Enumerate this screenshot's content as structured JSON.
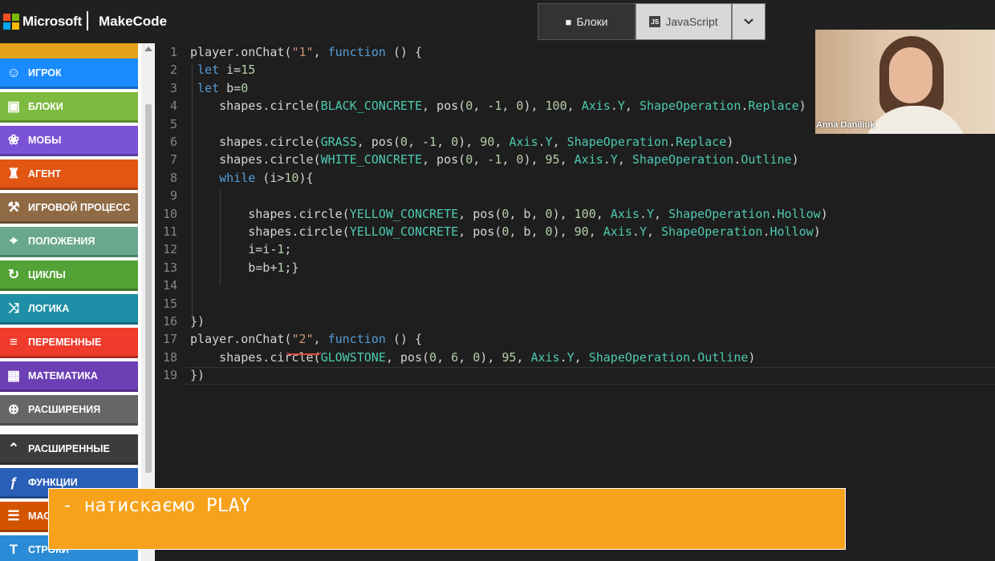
{
  "header": {
    "brand": "Microsoft",
    "product": "MakeCode",
    "mode_blocks": "Блоки",
    "mode_js": "JavaScript",
    "js_badge": "JS"
  },
  "sidebar": {
    "categories": [
      {
        "label": "",
        "icon": "truncated-icon",
        "color": "#e6a21a"
      },
      {
        "label": "ИГРОК",
        "icon": "person-icon",
        "color": "#1a8cff"
      },
      {
        "label": "БЛОКИ",
        "icon": "cube-icon",
        "color": "#7cbb3f"
      },
      {
        "label": "МОБЫ",
        "icon": "paw-icon",
        "color": "#7b53d6"
      },
      {
        "label": "АГЕНТ",
        "icon": "agent-icon",
        "color": "#e25513"
      },
      {
        "label": "ИГРОВОЙ ПРОЦЕСС",
        "icon": "wrench-icon",
        "color": "#8f6a44"
      },
      {
        "label": "ПОЛОЖЕНИЯ",
        "icon": "crosshair-icon",
        "color": "#6aa88e"
      },
      {
        "label": "ЦИКЛЫ",
        "icon": "loop-icon",
        "color": "#53a235"
      },
      {
        "label": "ЛОГИКА",
        "icon": "shuffle-icon",
        "color": "#1f8ea6"
      },
      {
        "label": "ПЕРЕМЕННЫЕ",
        "icon": "list-icon",
        "color": "#ee3b2b"
      },
      {
        "label": "МАТЕМАТИКА",
        "icon": "calculator-icon",
        "color": "#6c3fb4"
      },
      {
        "label": "РАСШИРЕНИЯ",
        "icon": "plus-circle-icon",
        "color": "#666666"
      },
      {
        "label": "РАСШИРЕННЫЕ",
        "icon": "chevron-up-icon",
        "color": "#3c3c3c"
      },
      {
        "label": "ФУНКЦИИ",
        "icon": "function-icon",
        "color": "#2a5fb8"
      },
      {
        "label": "МАС",
        "icon": "array-icon",
        "color": "#d35400"
      },
      {
        "label": "СТРОКИ",
        "icon": "text-icon",
        "color": "#2a8bd6"
      }
    ]
  },
  "editor": {
    "lines": [
      {
        "n": "1",
        "html": "player.onChat(<span class='str'>\"1\"</span>, <span class='kw'>function</span> () {"
      },
      {
        "n": "2",
        "html": " <span class='kw'>let</span> i=<span class='num'>15</span>"
      },
      {
        "n": "3",
        "html": " <span class='kw'>let</span> b=<span class='num'>0</span>"
      },
      {
        "n": "4",
        "html": "    shapes.circle(<span class='cn'>BLACK_CONCRETE</span>, pos(<span class='num'>0</span>, -<span class='num'>1</span>, <span class='num'>0</span>), <span class='num'>100</span>, <span class='cn'>Axis</span>.<span class='cn'>Y</span>, <span class='cn'>ShapeOperation</span>.<span class='cn'>Replace</span>)"
      },
      {
        "n": "5",
        "html": ""
      },
      {
        "n": "6",
        "html": "    shapes.circle(<span class='cn'>GRASS</span>, pos(<span class='num'>0</span>, -<span class='num'>1</span>, <span class='num'>0</span>), <span class='num'>90</span>, <span class='cn'>Axis</span>.<span class='cn'>Y</span>, <span class='cn'>ShapeOperation</span>.<span class='cn'>Replace</span>)"
      },
      {
        "n": "7",
        "html": "    shapes.circle(<span class='cn'>WHITE_CONCRETE</span>, pos(<span class='num'>0</span>, -<span class='num'>1</span>, <span class='num'>0</span>), <span class='num'>95</span>, <span class='cn'>Axis</span>.<span class='cn'>Y</span>, <span class='cn'>ShapeOperation</span>.<span class='cn'>Outline</span>)"
      },
      {
        "n": "8",
        "html": "    <span class='kw'>while</span> (i&gt;<span class='num'>10</span>){"
      },
      {
        "n": "9",
        "html": ""
      },
      {
        "n": "10",
        "html": "        shapes.circle(<span class='cn'>YELLOW_CONCRETE</span>, pos(<span class='num'>0</span>, b, <span class='num'>0</span>), <span class='num'>100</span>, <span class='cn'>Axis</span>.<span class='cn'>Y</span>, <span class='cn'>ShapeOperation</span>.<span class='cn'>Hollow</span>)"
      },
      {
        "n": "11",
        "html": "        shapes.circle(<span class='cn'>YELLOW_CONCRETE</span>, pos(<span class='num'>0</span>, b, <span class='num'>0</span>), <span class='num'>90</span>, <span class='cn'>Axis</span>.<span class='cn'>Y</span>, <span class='cn'>ShapeOperation</span>.<span class='cn'>Hollow</span>)"
      },
      {
        "n": "12",
        "html": "        i=i-<span class='num'>1</span>;"
      },
      {
        "n": "13",
        "html": "        b=b+<span class='num'>1</span>;}"
      },
      {
        "n": "14",
        "html": ""
      },
      {
        "n": "15",
        "html": ""
      },
      {
        "n": "16",
        "html": "})"
      },
      {
        "n": "17",
        "html": "player.onChat(<span class='str'>\"2\"</span>, <span class='kw'>function</span> () {"
      },
      {
        "n": "18",
        "html": "    shapes.circle(<span class='cn'>GLOWSTONE</span>, pos(<span class='num'>0</span>, <span class='num'>6</span>, <span class='num'>0</span>), <span class='num'>95</span>, <span class='cn'>Axis</span>.<span class='cn'>Y</span>, <span class='cn'>ShapeOperation</span>.<span class='cn'>Outline</span>)"
      },
      {
        "n": "19",
        "html": "})"
      }
    ]
  },
  "webcam": {
    "participant_name": "Anna Daniliuk"
  },
  "subtitle": {
    "text": "- натискаємо PLAY"
  }
}
